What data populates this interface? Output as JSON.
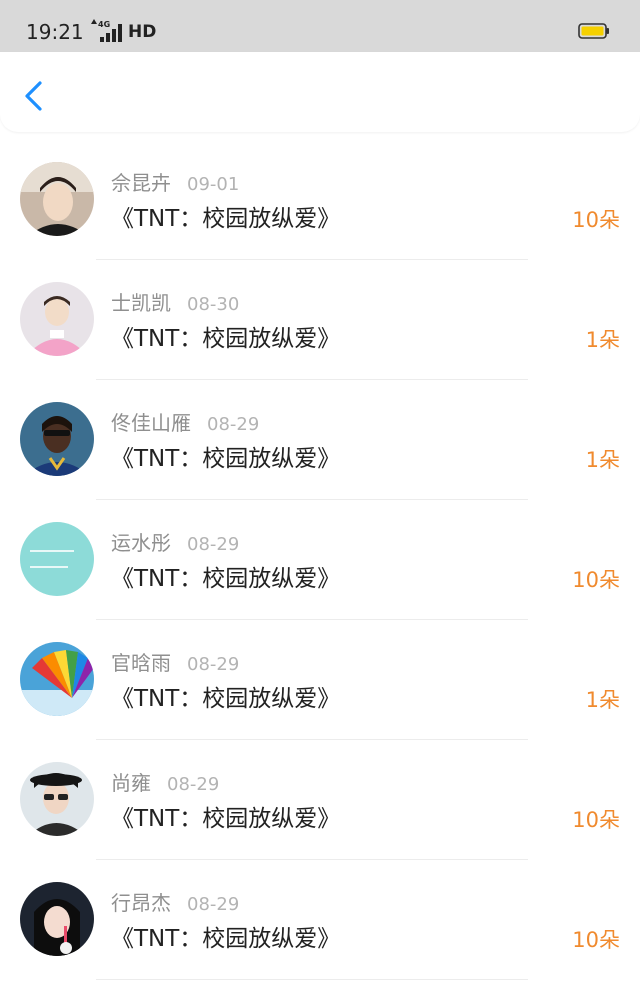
{
  "status_bar": {
    "time": "19:21",
    "network": "4G",
    "hd_label": "HD",
    "battery_color": "#f5d000"
  },
  "nav": {
    "back_icon": "chevron-left-icon",
    "accent_color": "#1e90ff"
  },
  "gifts": [
    {
      "name": "佘昆卉",
      "date": "09-01",
      "title": "《TNT：校园放纵爱》",
      "amount": "10朵",
      "avatar": "person-photo"
    },
    {
      "name": "士凯凯",
      "date": "08-30",
      "title": "《TNT：校园放纵爱》",
      "amount": "1朵",
      "avatar": "person-photo"
    },
    {
      "name": "佟佳山雁",
      "date": "08-29",
      "title": "《TNT：校园放纵爱》",
      "amount": "1朵",
      "avatar": "person-photo"
    },
    {
      "name": "运水彤",
      "date": "08-29",
      "title": "《TNT：校园放纵爱》",
      "amount": "10朵",
      "avatar": "text-image"
    },
    {
      "name": "官晗雨",
      "date": "08-29",
      "title": "《TNT：校园放纵爱》",
      "amount": "1朵",
      "avatar": "rainbow-fan-photo"
    },
    {
      "name": "尚雍",
      "date": "08-29",
      "title": "《TNT：校园放纵爱》",
      "amount": "10朵",
      "avatar": "person-photo"
    },
    {
      "name": "行昂杰",
      "date": "08-29",
      "title": "《TNT：校园放纵爱》",
      "amount": "10朵",
      "avatar": "person-photo"
    }
  ],
  "colors": {
    "amount": "#f08a2e",
    "name": "#8f8f8f",
    "date": "#b3b3b3",
    "title": "#222222"
  }
}
